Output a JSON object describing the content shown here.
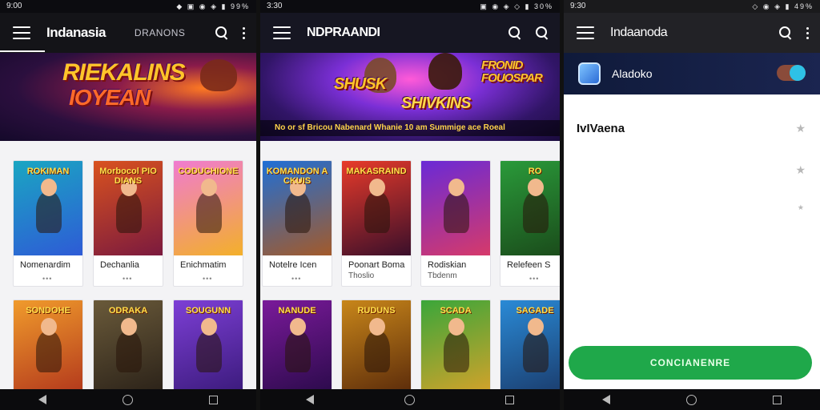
{
  "screens": [
    {
      "status_time": "9:00",
      "status_icons": "◆ ▣ ◉ ◈ ▮ 99%",
      "title": "Indanasia",
      "secondary_tab": "DRANONS",
      "banner_title_line1": "RIEKALINS",
      "banner_title_line2": "IOYEAN",
      "cards": [
        {
          "art_title": "ROKIMAN",
          "name": "Nomenardim",
          "sub": "•••",
          "colors": [
            "#1aa6c2",
            "#2e5bd6"
          ]
        },
        {
          "art_title": "Morbocol PIODIANS",
          "name": "Dechanlia",
          "sub": "•••",
          "colors": [
            "#d9521f",
            "#7b1a3e"
          ]
        },
        {
          "art_title": "CODUCHIONE",
          "name": "Enichmatim",
          "sub": "•••",
          "colors": [
            "#f07bd0",
            "#f3b02a"
          ]
        },
        {
          "art_title": "SONDOHE",
          "name": "",
          "sub": "",
          "colors": [
            "#f09b2c",
            "#b2371c"
          ]
        },
        {
          "art_title": "ODRAKA",
          "name": "",
          "sub": "",
          "colors": [
            "#6a5a3a",
            "#2a2118"
          ]
        },
        {
          "art_title": "SOUGUNN",
          "name": "",
          "sub": "",
          "colors": [
            "#7d3fd6",
            "#3a1a7a"
          ]
        }
      ]
    },
    {
      "status_time": "3:30",
      "status_icons": "▣ ◉ ◈ ◇ ▮ 30%",
      "title": "NDPRAANDI",
      "banner_title_line1": "SHUSK",
      "banner_title_line2": "SHIVKINS",
      "banner_right": "FRONID FOUOSPAR",
      "banner_caption": "No or sf Bricou   Nabenard Whanie 10 am Summige ace Roeal",
      "cards": [
        {
          "art_title": "KOMANDON ACKUIS",
          "name": "Notelre Icen",
          "sub": "•••",
          "colors": [
            "#1f6fd6",
            "#a35a2a"
          ]
        },
        {
          "art_title": "MAKASRAIND",
          "name": "Poonart Boma",
          "sub": "Thoslio",
          "colors": [
            "#e83a2a",
            "#3a0f2a"
          ]
        },
        {
          "art_title": "",
          "name": "Rodiskian",
          "sub": "Tbdenm",
          "colors": [
            "#6a2ad6",
            "#d63a6a"
          ]
        },
        {
          "art_title": "RO",
          "name": "Relefeen S",
          "sub": "•••",
          "colors": [
            "#2a9a3a",
            "#1a4a1a"
          ]
        },
        {
          "art_title": "NANUDE",
          "name": "",
          "sub": "",
          "colors": [
            "#7a1a9a",
            "#2a0a4a"
          ]
        },
        {
          "art_title": "RUDUNS",
          "name": "",
          "sub": "",
          "colors": [
            "#c8861a",
            "#5a2a0a"
          ]
        },
        {
          "art_title": "SCADA",
          "name": "",
          "sub": "",
          "colors": [
            "#3aa63a",
            "#d6a22a"
          ]
        },
        {
          "art_title": "SAGADE",
          "name": "",
          "sub": "",
          "colors": [
            "#2a8ad6",
            "#1a3a6a"
          ]
        }
      ]
    },
    {
      "status_time": "9:30",
      "status_icons": "◇ ◉ ◈ ▮ 49%",
      "title": "Indaanoda",
      "account_label": "Aladoko",
      "setting_label": "IvIVaena",
      "cta_label": "CONCIANENRE"
    }
  ],
  "colors": {
    "cta": "#1fa84a",
    "toggle_knob": "#2ec1e6",
    "appbar": "#141418"
  },
  "icons": [
    "menu-icon",
    "search-icon",
    "more-vert-icon",
    "star-icon",
    "back-icon",
    "home-icon",
    "recents-icon"
  ]
}
